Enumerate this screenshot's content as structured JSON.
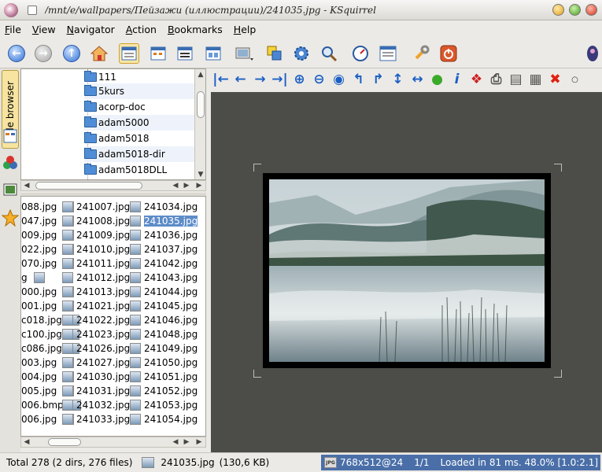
{
  "window": {
    "title": "/mnt/e/wallpapers/Пейзажи (иллюстрации)/241035.jpg - KSquirrel"
  },
  "menu": [
    "File",
    "View",
    "Navigator",
    "Action",
    "Bookmarks",
    "Help"
  ],
  "sidebar": {
    "file_browser_tab": "File browser"
  },
  "tree": {
    "items": [
      "111",
      "5kurs",
      "acorp-doc",
      "adam5000",
      "adam5018",
      "adam5018-dir",
      "adam5018DLL"
    ]
  },
  "files": {
    "col1": [
      "088.jpg",
      "047.jpg",
      "009.jpg",
      "022.jpg",
      "070.jpg",
      "g",
      "000.jpg",
      "001.jpg",
      "c018.jpg",
      "c100.jpg",
      "c086.jpg",
      "003.jpg",
      "004.jpg",
      "005.jpg",
      "006.bmp",
      "006.jpg"
    ],
    "col2": [
      "241007.jpg",
      "241008.jpg",
      "241009.jpg",
      "241010.jpg",
      "241011.jpg",
      "241012.jpg",
      "241013.jpg",
      "241021.jpg",
      "241022.jpg",
      "241023.jpg",
      "241026.jpg",
      "241027.jpg",
      "241030.jpg",
      "241031.jpg",
      "241032.jpg",
      "241033.jpg"
    ],
    "col3": [
      "241034.jpg",
      "241035.jpg",
      "241036.jpg",
      "241037.jpg",
      "241042.jpg",
      "241043.jpg",
      "241044.jpg",
      "241045.jpg",
      "241046.jpg",
      "241048.jpg",
      "241049.jpg",
      "241050.jpg",
      "241051.jpg",
      "241052.jpg",
      "241053.jpg",
      "241054.jpg"
    ],
    "selected": "241035.jpg"
  },
  "status": {
    "total": "Total 278 (2 dirs, 276 files)",
    "current_file": "241035.jpg",
    "current_size": "(130,6 KB)",
    "jpg_badge": "JPG",
    "dimensions": "768x512@24",
    "page": "1/1",
    "loaded": "Loaded in 81 ms. 48.0% [1.0:2.1]"
  },
  "colors": {
    "selection": "#5d8cc8",
    "viewer_bg": "#4c4c48",
    "status_highlight": "#4a6fa8"
  }
}
